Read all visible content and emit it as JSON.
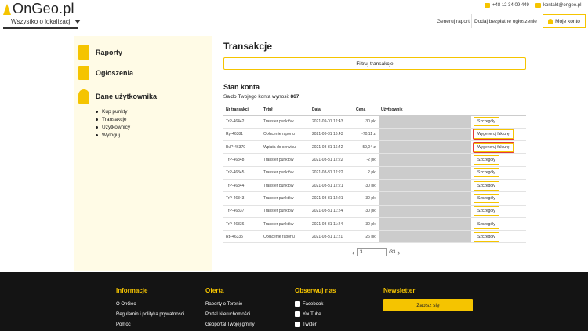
{
  "header": {
    "logo_text": "OnGeo.pl",
    "region": "Wszystko o lokalizacji",
    "phone": "+48 12 34 09 449",
    "email": "kontakt@ongeo.pl",
    "nav": [
      "Generuj raport",
      "Dodaj bezpłatne ogłoszenie"
    ],
    "account": "Moje konto"
  },
  "sidebar": {
    "sections": [
      "Raporty",
      "Ogłoszenia",
      "Dane użytkownika"
    ],
    "items": [
      "Kup punkty",
      "Transakcje",
      "Użytkownicy",
      "Wyloguj"
    ]
  },
  "main": {
    "title": "Transakcje",
    "filter_button": "Filtruj transakcje",
    "balance_title": "Stan konta",
    "balance_text": "Saldo Twojego konta wynosi:",
    "balance_value": "867",
    "columns": [
      "Nr transakcji",
      "Tytuł",
      "Data",
      "Cena",
      "Użytkownik",
      ""
    ],
    "rows": [
      {
        "id": "TrP-46442",
        "title": "Transfer punktów",
        "date": "2021-09-01 12:43",
        "price": "-30 pkt",
        "action": "Szczegóły"
      },
      {
        "id": "Rp-46381",
        "title": "Opłacenie raportu",
        "date": "2021-08-31 16:43",
        "price": "-70,11 zł",
        "action": "Wygeneruj fakturę"
      },
      {
        "id": "BuP-46379",
        "title": "Wpłata do serwisu",
        "date": "2021-08-31 16:42",
        "price": "59,04 zł",
        "action": "Wygeneruj fakturę"
      },
      {
        "id": "TrP-46348",
        "title": "Transfer punktów",
        "date": "2021-08-31 12:22",
        "price": "-2 pkt",
        "action": "Szczegóły"
      },
      {
        "id": "TrP-46345",
        "title": "Transfer punktów",
        "date": "2021-08-31 12:22",
        "price": "2 pkt",
        "action": "Szczegóły"
      },
      {
        "id": "TrP-46344",
        "title": "Transfer punktów",
        "date": "2021-08-31 12:21",
        "price": "-30 pkt",
        "action": "Szczegóły"
      },
      {
        "id": "TrP-46343",
        "title": "Transfer punktów",
        "date": "2021-08-31 12:21",
        "price": "30 pkt",
        "action": "Szczegóły"
      },
      {
        "id": "TrP-46337",
        "title": "Transfer punktów",
        "date": "2021-08-31 11:24",
        "price": "-30 pkt",
        "action": "Szczegóły"
      },
      {
        "id": "TrP-46336",
        "title": "Transfer punktów",
        "date": "2021-08-31 11:24",
        "price": "-30 pkt",
        "action": "Szczegóły"
      },
      {
        "id": "Rp-46335",
        "title": "Opłacenie raportu",
        "date": "2021-08-31 11:21",
        "price": "-26 pkt",
        "action": "Szczegóły"
      }
    ],
    "pager": {
      "page": "3",
      "total": "/33"
    }
  },
  "footer": {
    "info_title": "Informacje",
    "info_links": [
      "O OnGeo",
      "Regulamin i polityka prywatności",
      "Pomoc"
    ],
    "offer_title": "Oferta",
    "offer_links": [
      "Raporty o Terenie",
      "Portal Nieruchomości",
      "Geoportal Twojej gminy"
    ],
    "social_title": "Obserwuj nas",
    "social_links": [
      "Facebook",
      "YouTube",
      "Twitter"
    ],
    "newsletter_title": "Newsletter",
    "newsletter_button": "Zapisz się"
  },
  "colors": {
    "accent": "#f5c400",
    "footer_bg": "#141414",
    "highlight": "#e53935"
  }
}
